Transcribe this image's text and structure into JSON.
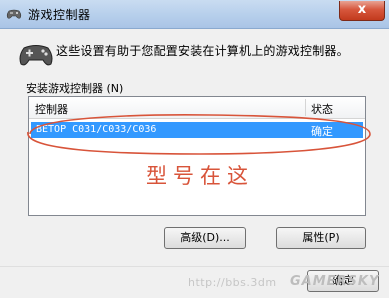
{
  "window": {
    "title": "游戏控制器",
    "close_label": "x"
  },
  "header": {
    "description": "这些设置有助于您配置安装在计算机上的游戏控制器。"
  },
  "list": {
    "group_label": "安装游戏控制器 (N)",
    "columns": [
      "控制器",
      "状态"
    ],
    "rows": [
      {
        "name": "BETOP C031/C033/C036",
        "status": "确定"
      }
    ]
  },
  "annotation": {
    "text": "型号在这",
    "color": "#d8543a"
  },
  "buttons": {
    "advanced": "高级(D)...",
    "properties": "属性(P)",
    "ok": "确定"
  },
  "watermark": {
    "url": "http://bbs.3dm",
    "logo": "GAMERSKY"
  },
  "colors": {
    "selection": "#3399ff",
    "titlebar": "#b8d0ec",
    "close": "#d7573d"
  },
  "icons": {
    "title": "gamepad-icon",
    "header": "gamepad-icon"
  }
}
